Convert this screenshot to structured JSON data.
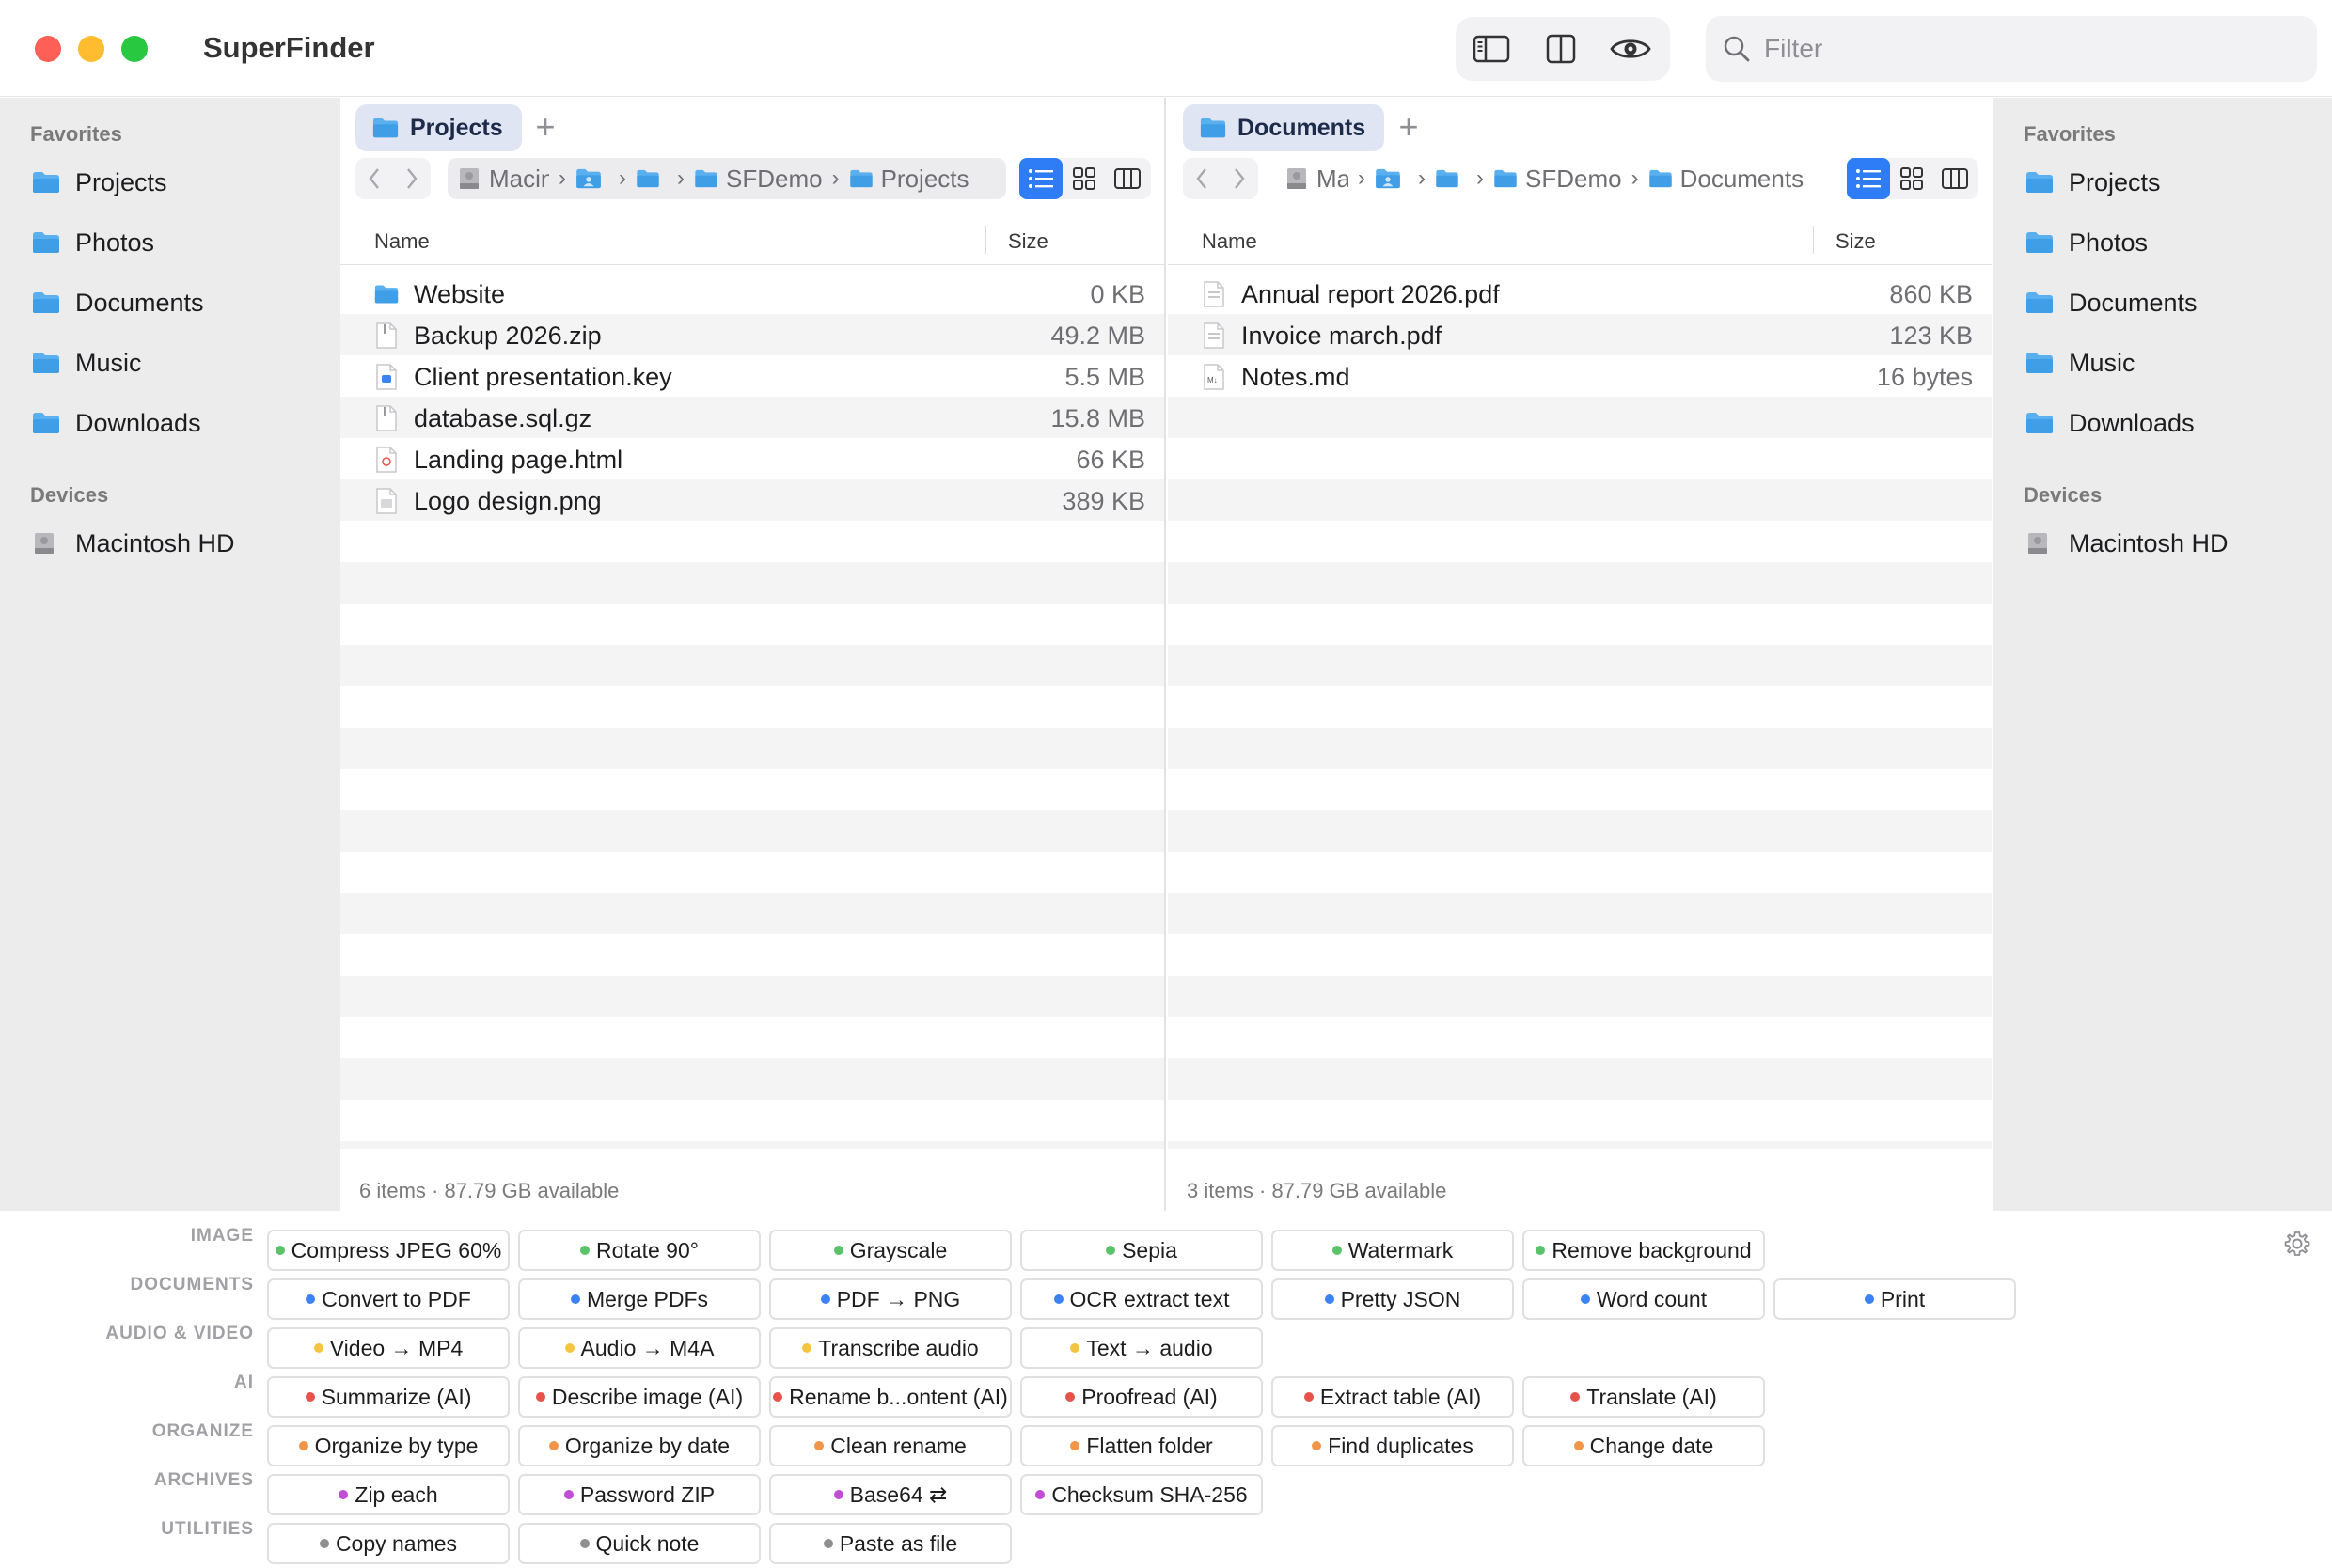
{
  "app": {
    "title": "SuperFinder"
  },
  "filter": {
    "placeholder": "Filter"
  },
  "sidebar": {
    "favorites_label": "Favorites",
    "devices_label": "Devices",
    "favorites": [
      {
        "label": "Projects"
      },
      {
        "label": "Photos"
      },
      {
        "label": "Documents"
      },
      {
        "label": "Music"
      },
      {
        "label": "Downloads"
      }
    ],
    "devices": [
      {
        "label": "Macintosh HD"
      }
    ]
  },
  "panes": [
    {
      "tab": "Projects",
      "breadcrumb": [
        "Macin",
        "",
        "",
        "SFDemo",
        "Projects"
      ],
      "columns": {
        "name": "Name",
        "size": "Size"
      },
      "files": [
        {
          "name": "Website",
          "size": "0 KB",
          "icon": "folder-icon"
        },
        {
          "name": "Backup 2026.zip",
          "size": "49.2 MB",
          "icon": "zip-file-icon"
        },
        {
          "name": "Client presentation.key",
          "size": "5.5 MB",
          "icon": "keynote-file-icon"
        },
        {
          "name": "database.sql.gz",
          "size": "15.8 MB",
          "icon": "zip-file-icon"
        },
        {
          "name": "Landing page.html",
          "size": "66 KB",
          "icon": "html-file-icon"
        },
        {
          "name": "Logo design.png",
          "size": "389 KB",
          "icon": "image-file-icon"
        }
      ],
      "status": "6 items · 87.79 GB available"
    },
    {
      "tab": "Documents",
      "breadcrumb": [
        "Ma",
        "",
        "",
        "SFDemo",
        "Documents"
      ],
      "columns": {
        "name": "Name",
        "size": "Size"
      },
      "files": [
        {
          "name": "Annual report 2026.pdf",
          "size": "860 KB",
          "icon": "pdf-file-icon"
        },
        {
          "name": "Invoice march.pdf",
          "size": "123 KB",
          "icon": "pdf-file-icon"
        },
        {
          "name": "Notes.md",
          "size": "16 bytes",
          "icon": "markdown-file-icon"
        }
      ],
      "status": "3 items · 87.79 GB available"
    }
  ],
  "colors": {
    "green": "#5ac36a",
    "blue": "#3b82f6",
    "yellow": "#f5c542",
    "red": "#e5534b",
    "orange": "#f0954a",
    "purple": "#c04fd6",
    "gray": "#8e8e93",
    "accent": "#2e7cf6"
  },
  "actions": [
    {
      "category": "IMAGE",
      "color": "green",
      "items": [
        "Compress JPEG 60%",
        "Rotate 90°",
        "Grayscale",
        "Sepia",
        "Watermark",
        "Remove background"
      ]
    },
    {
      "category": "DOCUMENTS",
      "color": "blue",
      "items": [
        "Convert to PDF",
        "Merge PDFs",
        "PDF → PNG",
        "OCR extract text",
        "Pretty JSON",
        "Word count",
        "Print"
      ]
    },
    {
      "category": "AUDIO & VIDEO",
      "color": "yellow",
      "items": [
        "Video → MP4",
        "Audio → M4A",
        "Transcribe audio",
        "Text → audio"
      ]
    },
    {
      "category": "AI",
      "color": "red",
      "items": [
        "Summarize (AI)",
        "Describe image (AI)",
        "Rename b...ontent (AI)",
        "Proofread (AI)",
        "Extract table (AI)",
        "Translate (AI)"
      ]
    },
    {
      "category": "ORGANIZE",
      "color": "orange",
      "items": [
        "Organize by type",
        "Organize by date",
        "Clean rename",
        "Flatten folder",
        "Find duplicates",
        "Change date"
      ]
    },
    {
      "category": "ARCHIVES",
      "color": "purple",
      "items": [
        "Zip each",
        "Password ZIP",
        "Base64 ⇄",
        "Checksum SHA-256"
      ]
    },
    {
      "category": "UTILITIES",
      "color": "gray",
      "items": [
        "Copy names",
        "Quick note",
        "Paste as file"
      ]
    }
  ]
}
